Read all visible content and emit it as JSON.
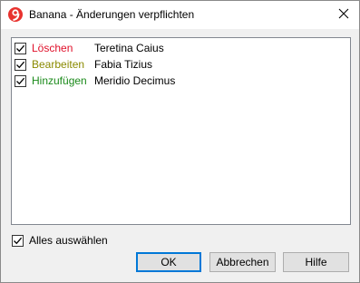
{
  "window": {
    "title": "Banana - Änderungen verpflichten",
    "app_icon": "banana-logo-icon",
    "close_icon": "close-icon"
  },
  "changes": [
    {
      "action": "Löschen",
      "action_color": "#e0102a",
      "name": "Teretina Caius",
      "checked": true
    },
    {
      "action": "Bearbeiten",
      "action_color": "#8a8a00",
      "name": "Fabia Tizius",
      "checked": true
    },
    {
      "action": "Hinzufügen",
      "action_color": "#1a8a1a",
      "name": "Meridio Decimus",
      "checked": true
    }
  ],
  "select_all": {
    "label": "Alles auswählen",
    "checked": true
  },
  "buttons": {
    "ok": "OK",
    "cancel": "Abbrechen",
    "help": "Hilfe"
  },
  "colors": {
    "accent": "#0078d7"
  }
}
